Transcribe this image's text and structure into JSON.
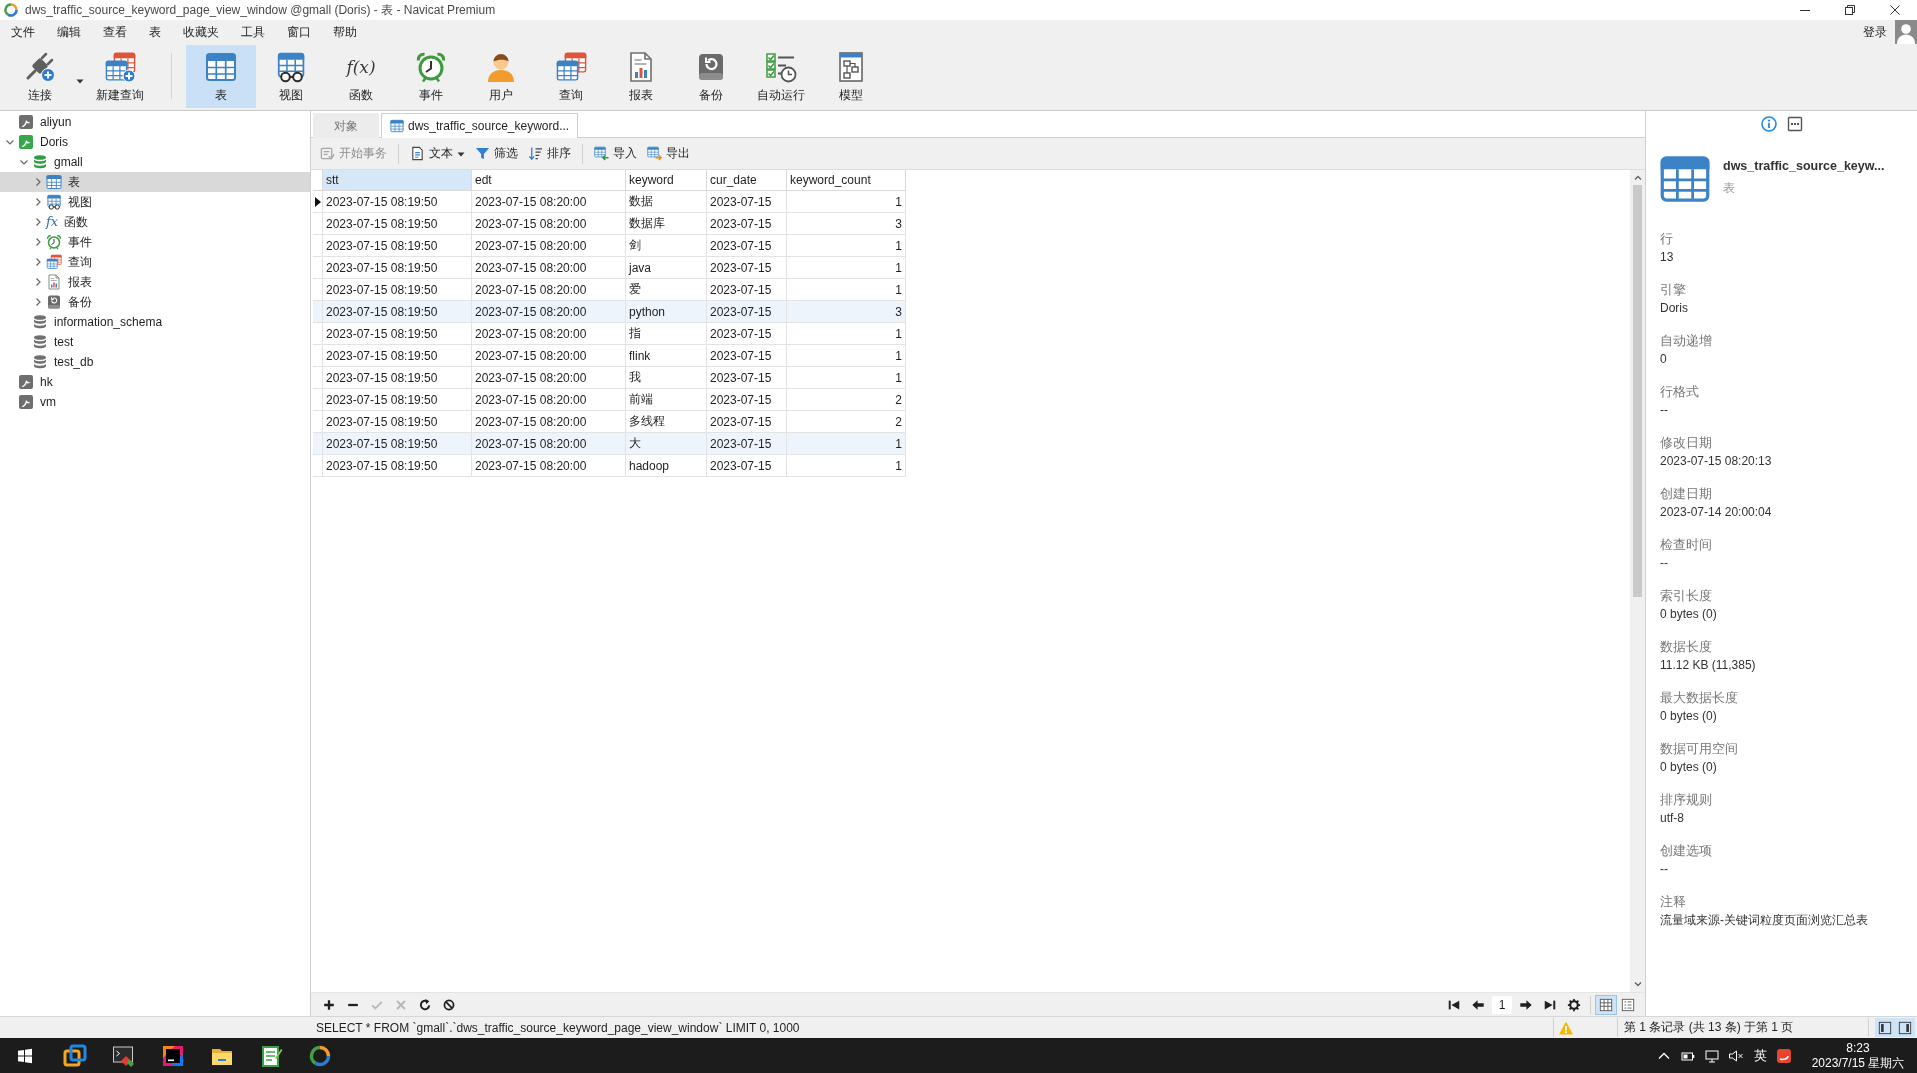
{
  "window": {
    "title": "dws_traffic_source_keyword_page_view_window @gmall (Doris) - 表 - Navicat Premium"
  },
  "menu": [
    "文件",
    "编辑",
    "查看",
    "表",
    "收藏夹",
    "工具",
    "窗口",
    "帮助"
  ],
  "account": {
    "label": "登录"
  },
  "toolbar": {
    "groups": [
      [
        {
          "kind": "connect",
          "label": "连接",
          "selected": false,
          "dropdown": true
        },
        {
          "kind": "new_query",
          "label": "新建查询",
          "selected": false,
          "dropdown": false
        }
      ],
      [
        {
          "kind": "table",
          "label": "表",
          "selected": true,
          "dropdown": false
        },
        {
          "kind": "view",
          "label": "视图",
          "selected": false,
          "dropdown": false
        },
        {
          "kind": "function",
          "label": "函数",
          "glyph": "f(x)",
          "selected": false,
          "dropdown": false
        },
        {
          "kind": "event",
          "label": "事件",
          "selected": false,
          "dropdown": false
        },
        {
          "kind": "user",
          "label": "用户",
          "selected": false,
          "dropdown": false
        },
        {
          "kind": "query",
          "label": "查询",
          "selected": false,
          "dropdown": false
        },
        {
          "kind": "report",
          "label": "报表",
          "selected": false,
          "dropdown": false
        },
        {
          "kind": "backup",
          "label": "备份",
          "selected": false,
          "dropdown": false
        },
        {
          "kind": "auto_run",
          "label": "自动运行",
          "selected": false,
          "dropdown": false
        },
        {
          "kind": "model",
          "label": "模型",
          "selected": false,
          "dropdown": false
        }
      ]
    ]
  },
  "sidebar": {
    "tree": [
      {
        "kind": "connection",
        "name": "aliyun",
        "connected": false,
        "selected": false
      },
      {
        "kind": "connection",
        "name": "Doris",
        "connected": true,
        "expanded": true,
        "selected": false,
        "children": [
          {
            "kind": "database",
            "name": "gmall",
            "open": true,
            "expanded": true,
            "selected": false,
            "children": [
              {
                "kind": "table",
                "name": "表",
                "expanded": false,
                "selected": true
              },
              {
                "kind": "view",
                "name": "视图",
                "expanded": false,
                "selected": false
              },
              {
                "kind": "function",
                "name": "函数",
                "glyph": "fx",
                "expanded": false,
                "selected": false
              },
              {
                "kind": "event",
                "name": "事件",
                "expanded": false,
                "selected": false
              },
              {
                "kind": "query",
                "name": "查询",
                "expanded": false,
                "selected": false
              },
              {
                "kind": "report",
                "name": "报表",
                "expanded": false,
                "selected": false
              },
              {
                "kind": "backup",
                "name": "备份",
                "expanded": false,
                "selected": false
              }
            ]
          },
          {
            "kind": "database",
            "name": "information_schema",
            "open": false,
            "selected": false
          },
          {
            "kind": "database",
            "name": "test",
            "open": false,
            "selected": false
          },
          {
            "kind": "database",
            "name": "test_db",
            "open": false,
            "selected": false
          }
        ]
      },
      {
        "kind": "connection",
        "name": "hk",
        "connected": false,
        "selected": false
      },
      {
        "kind": "connection",
        "name": "vm",
        "connected": false,
        "selected": false
      }
    ]
  },
  "tabs": [
    {
      "kind": "objects",
      "label": "对象",
      "selected": false
    },
    {
      "kind": "table",
      "label": "dws_traffic_source_keyword...",
      "selected": true
    }
  ],
  "grid_toolbar": {
    "groups": [
      [
        {
          "kind": "transaction",
          "label": "开始事务",
          "disabled": true,
          "dropdown": false
        }
      ],
      [
        {
          "kind": "text",
          "label": "文本",
          "disabled": false,
          "dropdown": true
        },
        {
          "kind": "filter",
          "label": "筛选",
          "disabled": false,
          "dropdown": false
        },
        {
          "kind": "sort",
          "label": "排序",
          "disabled": false,
          "dropdown": false
        }
      ],
      [
        {
          "kind": "import",
          "label": "导入",
          "disabled": false,
          "dropdown": false
        },
        {
          "kind": "export",
          "label": "导出",
          "disabled": false,
          "dropdown": false
        }
      ]
    ]
  },
  "table": {
    "columns": [
      {
        "name": "stt",
        "kind": "text",
        "selected": true
      },
      {
        "name": "edt",
        "kind": "text",
        "selected": false
      },
      {
        "name": "keyword",
        "kind": "text",
        "selected": false
      },
      {
        "name": "cur_date",
        "kind": "text",
        "selected": false
      },
      {
        "name": "keyword_count",
        "kind": "number",
        "selected": false
      }
    ],
    "rows": [
      {
        "selected": true,
        "highlighted": false,
        "cells": [
          "2023-07-15 08:19:50",
          "2023-07-15 08:20:00",
          "数据",
          "2023-07-15",
          "1"
        ]
      },
      {
        "selected": false,
        "highlighted": false,
        "cells": [
          "2023-07-15 08:19:50",
          "2023-07-15 08:20:00",
          "数据库",
          "2023-07-15",
          "3"
        ]
      },
      {
        "selected": false,
        "highlighted": false,
        "cells": [
          "2023-07-15 08:19:50",
          "2023-07-15 08:20:00",
          "剑",
          "2023-07-15",
          "1"
        ]
      },
      {
        "selected": false,
        "highlighted": false,
        "cells": [
          "2023-07-15 08:19:50",
          "2023-07-15 08:20:00",
          "java",
          "2023-07-15",
          "1"
        ]
      },
      {
        "selected": false,
        "highlighted": false,
        "cells": [
          "2023-07-15 08:19:50",
          "2023-07-15 08:20:00",
          "爱",
          "2023-07-15",
          "1"
        ]
      },
      {
        "selected": false,
        "highlighted": true,
        "cells": [
          "2023-07-15 08:19:50",
          "2023-07-15 08:20:00",
          "python",
          "2023-07-15",
          "3"
        ]
      },
      {
        "selected": false,
        "highlighted": false,
        "cells": [
          "2023-07-15 08:19:50",
          "2023-07-15 08:20:00",
          "指",
          "2023-07-15",
          "1"
        ]
      },
      {
        "selected": false,
        "highlighted": false,
        "cells": [
          "2023-07-15 08:19:50",
          "2023-07-15 08:20:00",
          "flink",
          "2023-07-15",
          "1"
        ]
      },
      {
        "selected": false,
        "highlighted": false,
        "cells": [
          "2023-07-15 08:19:50",
          "2023-07-15 08:20:00",
          "我",
          "2023-07-15",
          "1"
        ]
      },
      {
        "selected": false,
        "highlighted": false,
        "cells": [
          "2023-07-15 08:19:50",
          "2023-07-15 08:20:00",
          "前端",
          "2023-07-15",
          "2"
        ]
      },
      {
        "selected": false,
        "highlighted": false,
        "cells": [
          "2023-07-15 08:19:50",
          "2023-07-15 08:20:00",
          "多线程",
          "2023-07-15",
          "2"
        ]
      },
      {
        "selected": false,
        "highlighted": true,
        "cells": [
          "2023-07-15 08:19:50",
          "2023-07-15 08:20:00",
          "大",
          "2023-07-15",
          "1"
        ]
      },
      {
        "selected": false,
        "highlighted": false,
        "cells": [
          "2023-07-15 08:19:50",
          "2023-07-15 08:20:00",
          "hadoop",
          "2023-07-15",
          "1"
        ]
      }
    ]
  },
  "record_bar": {
    "buttons": [
      {
        "kind": "add",
        "disabled": false
      },
      {
        "kind": "delete",
        "disabled": false
      },
      {
        "kind": "apply",
        "disabled": true
      },
      {
        "kind": "discard",
        "disabled": true
      },
      {
        "kind": "refresh",
        "disabled": false
      },
      {
        "kind": "stop",
        "disabled": false
      }
    ],
    "pager": {
      "back": [
        {
          "kind": "first"
        },
        {
          "kind": "previous"
        }
      ],
      "page": "1",
      "forward": [
        {
          "kind": "next"
        },
        {
          "kind": "last"
        },
        {
          "kind": "settings"
        }
      ]
    },
    "views": [
      {
        "kind": "grid",
        "selected": true
      },
      {
        "kind": "form",
        "selected": false
      }
    ]
  },
  "info_panel": {
    "tabs": [
      {
        "kind": "info",
        "selected": true
      },
      {
        "kind": "ddl",
        "selected": false
      }
    ],
    "title": "dws_traffic_source_keyw...",
    "subtitle": "表",
    "properties": [
      {
        "label": "行",
        "value": "13"
      },
      {
        "label": "引擎",
        "value": "Doris"
      },
      {
        "label": "自动递增",
        "value": "0"
      },
      {
        "label": "行格式",
        "value": "--"
      },
      {
        "label": "修改日期",
        "value": "2023-07-15 08:20:13"
      },
      {
        "label": "创建日期",
        "value": "2023-07-14 20:00:04"
      },
      {
        "label": "检查时间",
        "value": "--"
      },
      {
        "label": "索引长度",
        "value": "0 bytes (0)"
      },
      {
        "label": "数据长度",
        "value": "11.12 KB (11,385)"
      },
      {
        "label": "最大数据长度",
        "value": "0 bytes (0)"
      },
      {
        "label": "数据可用空间",
        "value": "0 bytes (0)"
      },
      {
        "label": "排序规则",
        "value": "utf-8"
      },
      {
        "label": "创建选项",
        "value": "--"
      },
      {
        "label": "注释",
        "value": "流量域来源-关键词粒度页面浏览汇总表"
      }
    ]
  },
  "status_bar": {
    "sql": "SELECT * FROM `gmall`.`dws_traffic_source_keyword_page_view_window` LIMIT 0, 1000",
    "warning": true,
    "record_info": "第 1 条记录 (共 13 条) 于第 1 页",
    "panes": [
      {
        "kind": "left",
        "selected": true
      },
      {
        "kind": "right",
        "selected": true
      }
    ]
  },
  "taskbar": {
    "apps": [
      {
        "kind": "squares"
      },
      {
        "kind": "terminal"
      },
      {
        "kind": "ide"
      },
      {
        "kind": "folder"
      },
      {
        "kind": "notepad"
      },
      {
        "kind": "ring"
      }
    ],
    "tray_icons": [
      {
        "kind": "chevron"
      },
      {
        "kind": "power"
      },
      {
        "kind": "network"
      },
      {
        "kind": "muted"
      }
    ],
    "ime": "英",
    "tray_apps": [
      {
        "kind": "input_method"
      }
    ],
    "time": "8:23",
    "date": "2023/7/15 星期六"
  }
}
